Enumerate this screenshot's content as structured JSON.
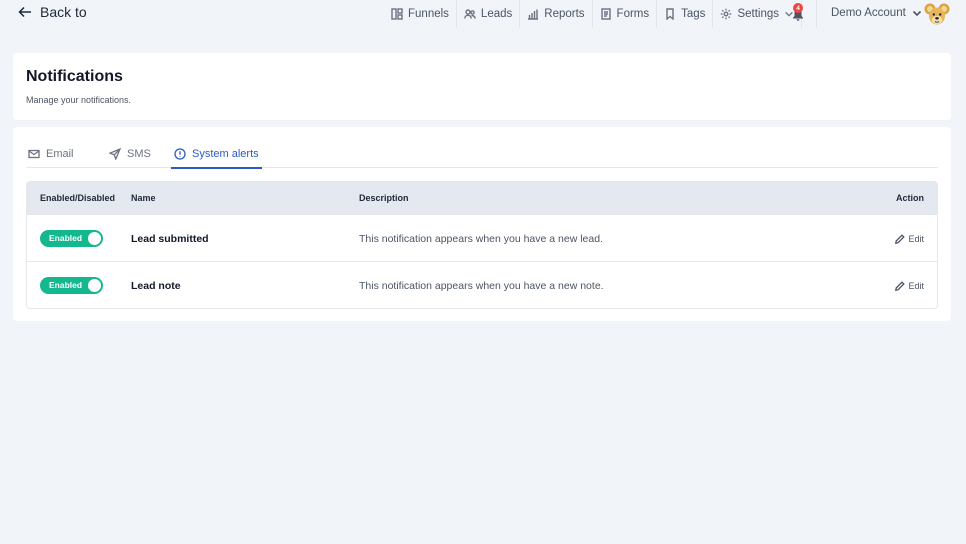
{
  "topbar": {
    "back_label": "Back to",
    "nav": [
      {
        "label": "Funnels",
        "icon": "funnels-icon"
      },
      {
        "label": "Leads",
        "icon": "users-icon"
      },
      {
        "label": "Reports",
        "icon": "bar-chart-icon"
      },
      {
        "label": "Forms",
        "icon": "document-icon"
      },
      {
        "label": "Tags",
        "icon": "bookmark-icon"
      },
      {
        "label": "Settings",
        "icon": "gear-icon"
      }
    ],
    "notification_count": "4",
    "account_label": "Demo Account"
  },
  "header": {
    "title": "Notifications",
    "subtitle": "Manage your notifications."
  },
  "tabs": [
    {
      "label": "Email",
      "icon": "mail-icon"
    },
    {
      "label": "SMS",
      "icon": "send-icon"
    },
    {
      "label": "System alerts",
      "icon": "alert-circle-icon",
      "active": true
    }
  ],
  "table": {
    "columns": {
      "enabled": "Enabled/Disabled",
      "name": "Name",
      "description": "Description",
      "action": "Action"
    },
    "rows": [
      {
        "toggle": "Enabled",
        "name": "Lead submitted",
        "description": "This notification appears when you have a new lead.",
        "action": "Edit"
      },
      {
        "toggle": "Enabled",
        "name": "Lead note",
        "description": "This notification appears when you have a new note.",
        "action": "Edit"
      }
    ]
  },
  "colors": {
    "accent": "#2b5bc9",
    "toggle_on": "#14b88f",
    "badge": "#ef4444",
    "background": "#f1f4f9"
  }
}
